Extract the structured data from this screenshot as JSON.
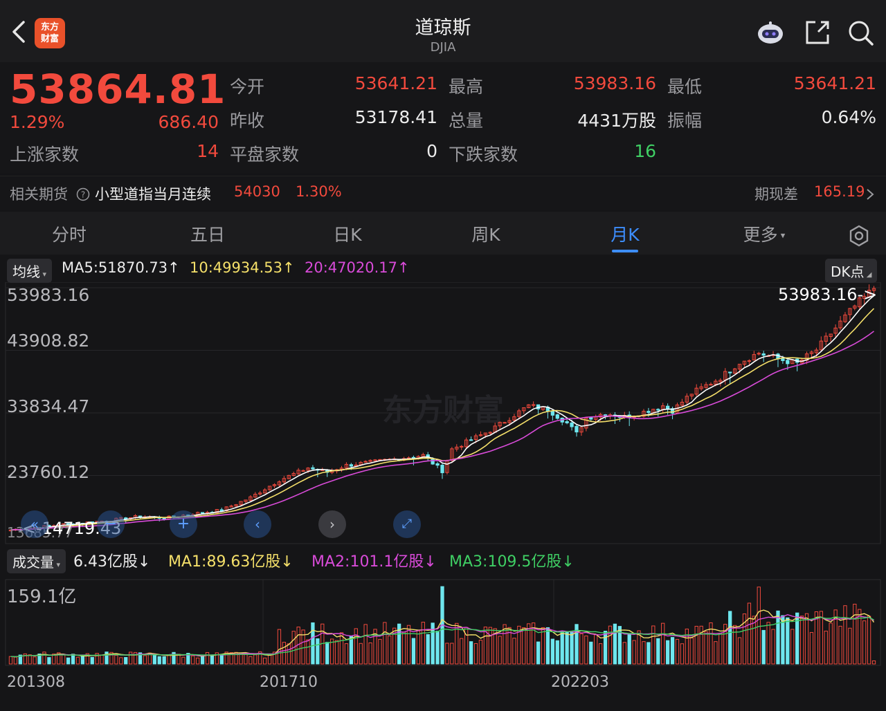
{
  "header": {
    "title": "道琼斯",
    "subtitle": "DJIA",
    "logo_text": "东方财富"
  },
  "quote": {
    "price": "53864.81",
    "change_pct": "1.29%",
    "change": "686.40",
    "open_label": "今开",
    "open": "53641.21",
    "high_label": "最高",
    "high": "53983.16",
    "low_label": "最低",
    "low": "53641.21",
    "prev_close_label": "昨收",
    "prev_close": "53178.41",
    "volume_label": "总量",
    "volume": "4431万股",
    "amplitude_label": "振幅",
    "amplitude": "0.64%",
    "advancers_label": "上涨家数",
    "advancers": "14",
    "unchanged_label": "平盘家数",
    "unchanged": "0",
    "decliners_label": "下跌家数",
    "decliners": "16"
  },
  "futures": {
    "label": "相关期货",
    "name": "小型道指当月连续",
    "price": "54030",
    "pct": "1.30%",
    "basis_label": "期现差",
    "basis": "165.19"
  },
  "tabs": [
    {
      "label": "分时"
    },
    {
      "label": "五日"
    },
    {
      "label": "日K"
    },
    {
      "label": "周K"
    },
    {
      "label": "月K"
    },
    {
      "label": "更多"
    }
  ],
  "active_tab": "月K",
  "ma": {
    "selector": "均线",
    "ma5": "MA5:51870.73↑",
    "ma10": "10:49934.53↑",
    "ma20": "20:47020.17↑",
    "dk_button": "DK点"
  },
  "volume_row": {
    "selector": "成交量",
    "vol": "6.43亿股↓",
    "ma1": "MA1:89.63亿股↓",
    "ma2": "MA2:101.1亿股↓",
    "ma3": "MA3:109.5亿股↓",
    "max_label": "159.1亿"
  },
  "colors": {
    "up": "#f24a3d",
    "down": "#6ee6ee",
    "ma5": "#ffffff",
    "ma10": "#f5e06a",
    "ma20": "#d94bd9",
    "accent": "#3d8eff"
  },
  "chart_data": {
    "type": "candlestick",
    "price_axis_labels": [
      "53983.16",
      "43908.82",
      "33834.47",
      "23760.12",
      "13685.77"
    ],
    "ylim": [
      13685.77,
      53983.16
    ],
    "max_marker": "53983.16->",
    "min_marker": "<-14719.43",
    "x_tick_labels": [
      "201308",
      "201710",
      "202203"
    ],
    "watermark": "东方财富",
    "anchor_closes": [
      [
        0,
        15000
      ],
      [
        10,
        15800
      ],
      [
        20,
        16500
      ],
      [
        27,
        17200
      ],
      [
        32,
        16900
      ],
      [
        38,
        17600
      ],
      [
        44,
        18200
      ],
      [
        50,
        20200
      ],
      [
        56,
        23000
      ],
      [
        62,
        25000
      ],
      [
        66,
        24300
      ],
      [
        70,
        25400
      ],
      [
        76,
        26000
      ],
      [
        82,
        26600
      ],
      [
        86,
        27000
      ],
      [
        90,
        24500
      ],
      [
        92,
        28000
      ],
      [
        96,
        29500
      ],
      [
        100,
        31000
      ],
      [
        104,
        33000
      ],
      [
        108,
        35000
      ],
      [
        112,
        34400
      ],
      [
        116,
        32200
      ],
      [
        118,
        30500
      ],
      [
        120,
        33000
      ],
      [
        124,
        33800
      ],
      [
        128,
        33200
      ],
      [
        132,
        34000
      ],
      [
        136,
        35000
      ],
      [
        138,
        34200
      ],
      [
        142,
        37000
      ],
      [
        148,
        39500
      ],
      [
        152,
        42000
      ],
      [
        156,
        43500
      ],
      [
        160,
        42500
      ],
      [
        164,
        41800
      ],
      [
        168,
        44000
      ],
      [
        172,
        47500
      ],
      [
        176,
        51000
      ],
      [
        180,
        53864.81
      ]
    ],
    "volume_ylim": [
      0,
      159.1
    ],
    "volume_unit": "亿股"
  }
}
